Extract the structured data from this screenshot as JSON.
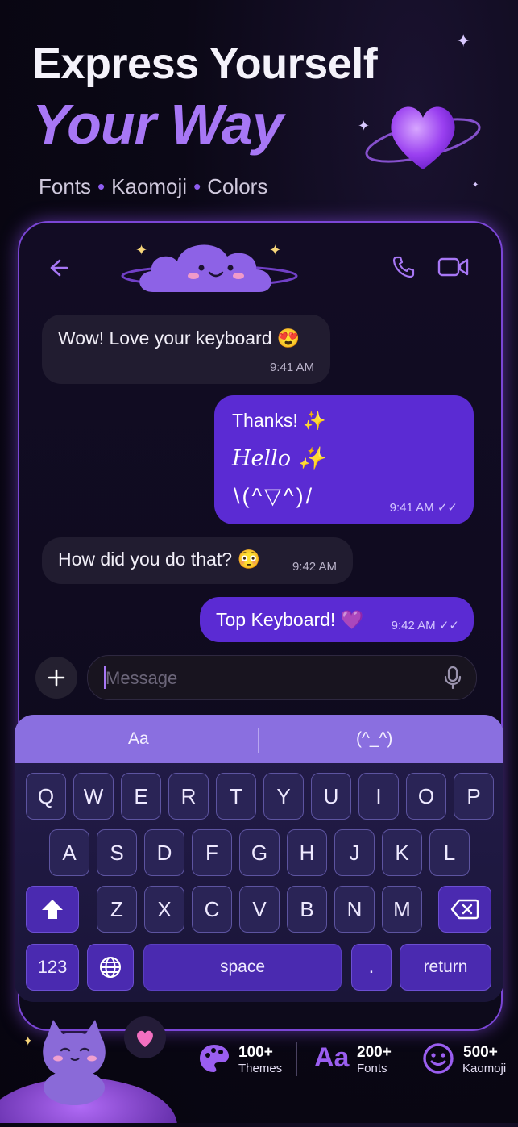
{
  "header": {
    "line1": "Express Yourself",
    "line2": "Your Way",
    "features": [
      "Fonts",
      "Kaomoji",
      "Colors"
    ]
  },
  "chat": {
    "messages": [
      {
        "direction": "in",
        "text": "Wow! Love your keyboard 😍",
        "time": "9:41 AM"
      },
      {
        "direction": "out",
        "lines": [
          "Thanks! ✨",
          "Hello ✨",
          "\\(^▽^)/"
        ],
        "time": "9:41 AM"
      },
      {
        "direction": "in",
        "text": "How did you do that? 😳",
        "time": "9:42 AM"
      },
      {
        "direction": "out",
        "text": "Top Keyboard! 💜",
        "time": "9:42 AM"
      }
    ],
    "input_placeholder": "Message"
  },
  "keyboard": {
    "tabs": [
      "Aa",
      "(^_^)"
    ],
    "row1": [
      "Q",
      "W",
      "E",
      "R",
      "T",
      "Y",
      "U",
      "I",
      "O",
      "P"
    ],
    "row2": [
      "A",
      "S",
      "D",
      "F",
      "G",
      "H",
      "J",
      "K",
      "L"
    ],
    "row3": [
      "Z",
      "X",
      "C",
      "V",
      "B",
      "N",
      "M"
    ],
    "bottom": {
      "numbers": "123",
      "space": "space",
      "period": ".",
      "return": "return"
    }
  },
  "stats": [
    {
      "value": "100+",
      "label": "Themes",
      "icon": "palette-icon"
    },
    {
      "value": "200+",
      "label": "Fonts",
      "icon": "aa-icon",
      "glyph": "Aa"
    },
    {
      "value": "500+",
      "label": "Kaomoji",
      "icon": "smiley-icon"
    }
  ],
  "colors": {
    "accent": "#a777f5",
    "bubble_out": "#5b2bd3",
    "bubble_in": "#211c30",
    "keyboard_bar": "#8a6fe0"
  }
}
